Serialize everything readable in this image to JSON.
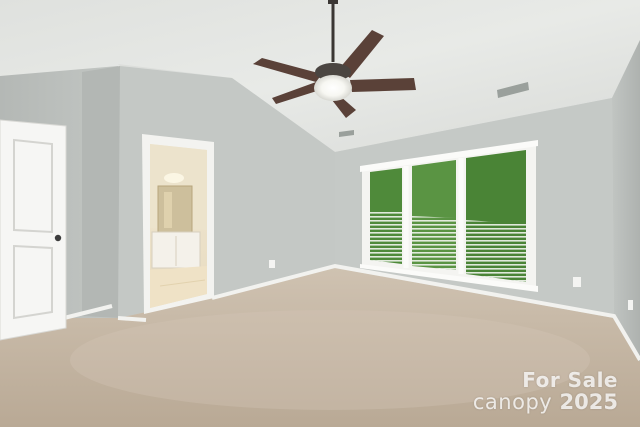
{
  "watermark": {
    "line1": "For Sale",
    "brand": "canopy",
    "year": "2025"
  },
  "colors": {
    "ceiling": "#e4e6e3",
    "wall_left": "#bcc0bd",
    "wall_back": "#c3c7c4",
    "wall_right": "#b7bbb8",
    "carpet": "#c7b8a5",
    "baseboard": "#f2f2ef",
    "door": "#f6f6f4",
    "foliage": "#4f8a3a"
  }
}
